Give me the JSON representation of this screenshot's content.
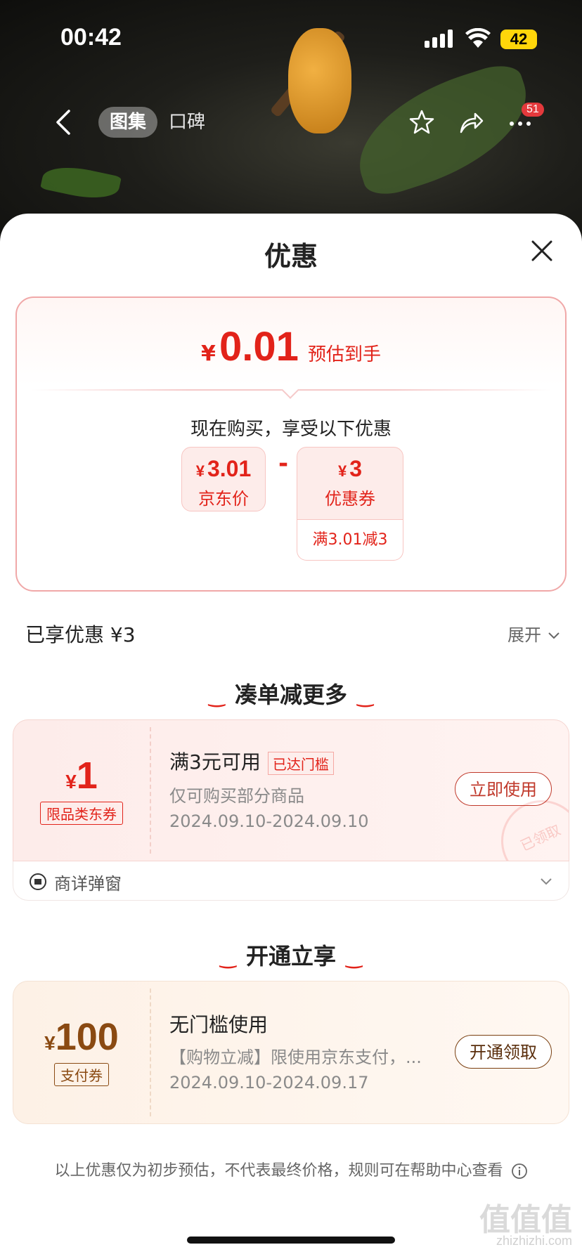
{
  "status": {
    "time": "00:42",
    "battery": "42"
  },
  "nav": {
    "tab_active": "图集",
    "tab_other": "口碑",
    "badge": "51"
  },
  "sheet": {
    "title": "优惠"
  },
  "estimate": {
    "yen": "¥",
    "price": "0.01",
    "label": "预估到手",
    "subtitle": "现在购买，享受以下优惠",
    "jd_price": {
      "yen": "¥",
      "value": "3.01",
      "label": "京东价"
    },
    "minus": "-",
    "coupon": {
      "yen": "¥",
      "value": "3",
      "label": "优惠券",
      "condition": "满3.01减3"
    }
  },
  "enjoyed": {
    "text": "已享优惠 ¥3",
    "expand": "展开"
  },
  "section1": {
    "title": "凑单减更多"
  },
  "coupon1": {
    "yen": "¥",
    "amount": "1",
    "tag": "限品类东券",
    "title": "满3元可用",
    "reach_badge": "已达门槛",
    "desc": "仅可购买部分商品",
    "dates": "2024.09.10-2024.09.10",
    "button": "立即使用",
    "stamp": "已领取",
    "footer": "商详弹窗"
  },
  "section2": {
    "title": "开通立享"
  },
  "coupon2": {
    "yen": "¥",
    "amount": "100",
    "tag": "支付券",
    "title": "无门槛使用",
    "desc": "【购物立减】限使用京东支付，...",
    "dates": "2024.09.10-2024.09.17",
    "button": "开通领取"
  },
  "disclaimer": "以上优惠仅为初步预估，不代表最终价格，规则可在帮助中心查看",
  "watermark": {
    "logo": "值值值",
    "site": "zhizhizhi.com"
  },
  "colors": {
    "accent": "#e2231a",
    "gold": "#8a4a12"
  }
}
